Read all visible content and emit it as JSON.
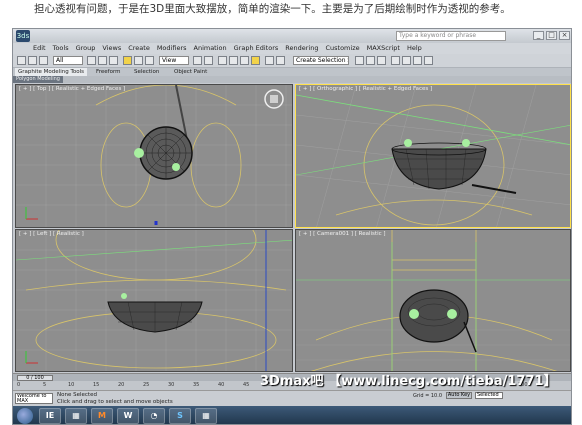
{
  "caption": "担心透视有问题，于是在3D里面大致摆放，简单的渲染一下。主要是为了后期绘制时作为透视的参考。",
  "window": {
    "app_logo": "3ds",
    "search_placeholder": "Type a keyword or phrase",
    "buttons": [
      "_",
      "□",
      "×"
    ]
  },
  "menu": [
    "Edit",
    "Tools",
    "Group",
    "Views",
    "Create",
    "Modifiers",
    "Animation",
    "Graph Editors",
    "Rendering",
    "Customize",
    "MAXScript",
    "Help"
  ],
  "toolbar": {
    "selection_filter": "All",
    "view_dropdown": "View",
    "named_selection": "Create Selection Set"
  },
  "ribbon": {
    "tabs": [
      "Graphite Modeling Tools",
      "Freeform",
      "Selection",
      "Object Paint"
    ],
    "sub_tab": "Polygon Modeling"
  },
  "viewports": [
    {
      "label": "[ + ] [ Top ] [ Realistic + Edged Faces ]",
      "active": false
    },
    {
      "label": "[ + ] [ Orthographic ] [ Realistic + Edged Faces ]",
      "active": true
    },
    {
      "label": "[ + ] [ Left ] [ Realistic ]",
      "active": false
    },
    {
      "label": "[ + ] [ Camera001 ] [ Realistic ]",
      "active": false
    }
  ],
  "timeline": {
    "slider": "0 / 100"
  },
  "ruler_ticks": [
    "0",
    "5",
    "10",
    "15",
    "20",
    "25",
    "30",
    "35",
    "40",
    "45",
    "50",
    "55",
    "60",
    "65",
    "70",
    "75",
    "80",
    "85",
    "90",
    "95",
    "100"
  ],
  "status": {
    "maxscript": "Welcome to MAX",
    "selection": "None Selected",
    "prompt": "Click and drag to select and move objects",
    "grid": "Grid = 10.0",
    "auto_key": "Auto Key",
    "key_filter": "Selected"
  },
  "taskbar": {
    "apps": [
      "IE",
      "▦",
      "M",
      "W",
      "◔",
      "S",
      "▦"
    ]
  },
  "watermark": "3Dmax吧 【www.linecg.com/tieba/1771】"
}
